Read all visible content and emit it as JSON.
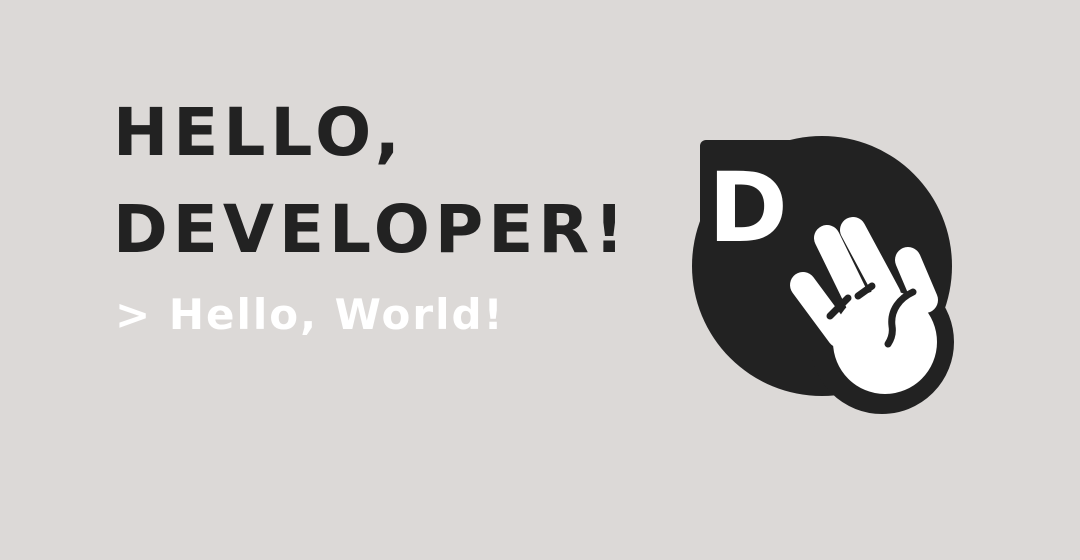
{
  "headline": {
    "line1": "HELLO,",
    "line2": "DEVELOPER!"
  },
  "subline": "> Hello, World!",
  "logo": {
    "letter": "D",
    "icon": "waving-hand-icon"
  },
  "colors": {
    "background": "#dcd9d7",
    "dark": "#222222",
    "light": "#ffffff"
  }
}
